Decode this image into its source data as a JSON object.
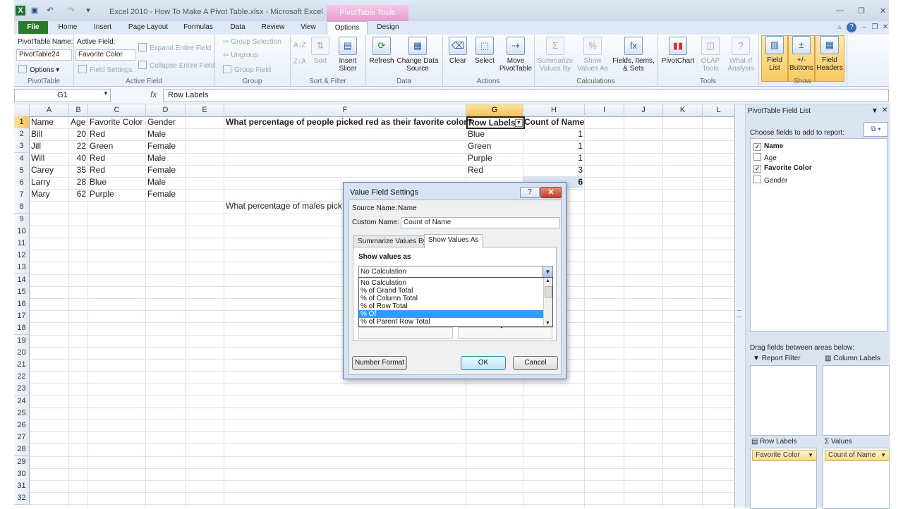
{
  "window": {
    "title": "Excel 2010 - How To Make A Pivot Table.xlsx - Microsoft Excel",
    "context_tab": "PivotTable Tools"
  },
  "tabs": [
    "File",
    "Home",
    "Insert",
    "Page Layout",
    "Formulas",
    "Data",
    "Review",
    "View",
    "Options",
    "Design"
  ],
  "ribbon": {
    "pivottable_group": {
      "name_label": "PivotTable Name:",
      "name_value": "PivotTable24",
      "options": "Options",
      "label": "PivotTable"
    },
    "active_field_group": {
      "label_top": "Active Field:",
      "value": "Favorite Color",
      "field_settings": "Field Settings",
      "expand": "Expand Entire Field",
      "collapse": "Collapse Entire Field",
      "label": "Active Field"
    },
    "group_group": {
      "group_selection": "Group Selection",
      "ungroup": "Ungroup",
      "group_field": "Group Field",
      "label": "Group"
    },
    "sort_group": {
      "sort": "Sort",
      "label": "Sort & Filter",
      "insert_slicer": "Insert Slicer"
    },
    "data_group": {
      "refresh": "Refresh",
      "change_source": "Change Data Source",
      "label": "Data"
    },
    "actions_group": {
      "clear": "Clear",
      "select": "Select",
      "move": "Move PivotTable",
      "label": "Actions"
    },
    "calculations_group": {
      "summarize": "Summarize Values By",
      "show": "Show Values As",
      "fields": "Fields, Items, & Sets",
      "label": "Calculations"
    },
    "tools_group": {
      "pivotchart": "PivotChart",
      "olap": "OLAP Tools",
      "whatif": "What-If Analysis",
      "label": "Tools"
    },
    "show_group": {
      "field_list": "Field List",
      "buttons": "+/- Buttons",
      "headers": "Field Headers",
      "label": "Show"
    }
  },
  "formula_bar": {
    "name_box": "G1",
    "fx": "fx",
    "formula": "Row Labels"
  },
  "columns": [
    "A",
    "B",
    "C",
    "D",
    "E",
    "F",
    "G",
    "H",
    "I",
    "J",
    "K",
    "L"
  ],
  "rows": [
    "1",
    "2",
    "3",
    "4",
    "5",
    "6",
    "7",
    "8",
    "9",
    "10",
    "11",
    "12",
    "13",
    "14",
    "15",
    "16",
    "17",
    "18",
    "19",
    "20",
    "21",
    "22",
    "23",
    "24",
    "25",
    "26",
    "27",
    "28",
    "29",
    "30",
    "31",
    "32"
  ],
  "sheet": {
    "headers": {
      "name": "Name",
      "age": "Age",
      "color": "Favorite Color",
      "gender": "Gender"
    },
    "data": [
      {
        "name": "Bill",
        "age": "20",
        "color": "Red",
        "gender": "Male"
      },
      {
        "name": "Jill",
        "age": "22",
        "color": "Green",
        "gender": "Female"
      },
      {
        "name": "Will",
        "age": "40",
        "color": "Red",
        "gender": "Male"
      },
      {
        "name": "Carey",
        "age": "35",
        "color": "Red",
        "gender": "Female"
      },
      {
        "name": "Larry",
        "age": "28",
        "color": "Blue",
        "gender": "Male"
      },
      {
        "name": "Mary",
        "age": "62",
        "color": "Purple",
        "gender": "Female"
      }
    ],
    "question1": "What percentage of people picked red as their favorite color?",
    "question2": "What percentage of males pick",
    "pivot": {
      "row_labels": "Row Labels",
      "count_header": "Count of Name",
      "rows": [
        {
          "label": "Blue",
          "count": "1"
        },
        {
          "label": "Green",
          "count": "1"
        },
        {
          "label": "Purple",
          "count": "1"
        },
        {
          "label": "Red",
          "count": "3"
        }
      ],
      "total": "6"
    }
  },
  "field_list": {
    "title": "PivotTable Field List",
    "choose": "Choose fields to add to report:",
    "fields": [
      {
        "label": "Name",
        "checked": "✓"
      },
      {
        "label": "Age",
        "checked": ""
      },
      {
        "label": "Favorite Color",
        "checked": "✓"
      },
      {
        "label": "Gender",
        "checked": ""
      }
    ],
    "drag_text": "Drag fields between areas below:",
    "report_filter": "Report Filter",
    "column_labels": "Column Labels",
    "row_labels": "Row Labels",
    "values": "Values",
    "row_chip": "Favorite Color",
    "values_chip": "Count of Name"
  },
  "dialog": {
    "title": "Value Field Settings",
    "help": "?",
    "close": "✕",
    "source_label": "Source Name:",
    "source_value": "Name",
    "custom_label": "Custom Name:",
    "custom_value": "Count of Name",
    "tab_summarize": "Summarize Values By",
    "tab_show": "Show Values As",
    "show_values_as": "Show values as",
    "selected": "No Calculation",
    "options": [
      "No Calculation",
      "% of Grand Total",
      "% of Column Total",
      "% of Row Total",
      "% Of",
      "% of Parent Row Total"
    ],
    "number_format": "Number Format",
    "ok": "OK",
    "cancel": "Cancel"
  },
  "colors": {
    "accent": "#3399ff",
    "file_tab": "#2c7a2c",
    "pivot_tools": "#e89ad0",
    "selection": "#f5c258"
  }
}
